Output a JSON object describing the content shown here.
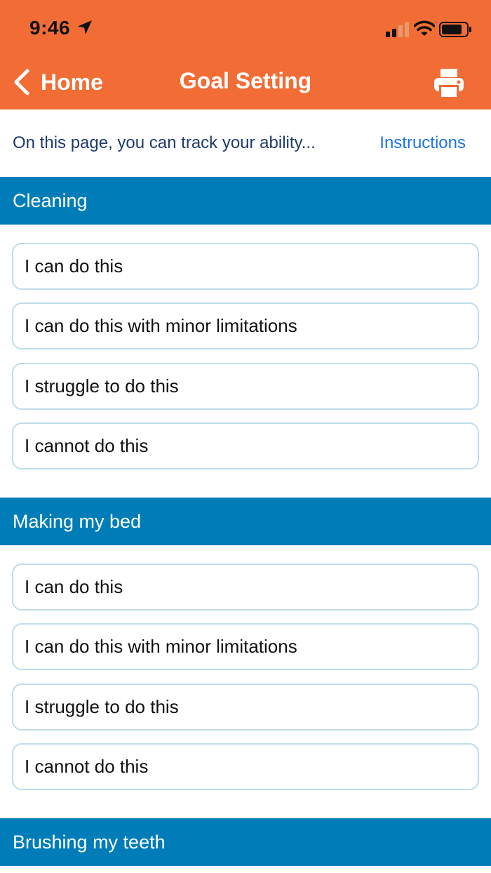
{
  "status_bar": {
    "time": "9:46",
    "icons": [
      "location-arrow-icon",
      "cellular-signal-icon",
      "wifi-icon",
      "battery-icon"
    ]
  },
  "nav": {
    "back_label": "Home",
    "title": "Goal Setting",
    "print_icon": "printer-icon"
  },
  "intro": {
    "text": "On this page, you can track your ability...",
    "instructions_label": "Instructions"
  },
  "colors": {
    "header_orange": "#F26D35",
    "section_blue": "#007DB8",
    "link_blue": "#1A73E8",
    "option_border": "#BFDCEB"
  },
  "sections": [
    {
      "title": "Cleaning",
      "options": [
        "I can do this",
        "I can do this with minor limitations",
        "I struggle to do this",
        "I cannot do this"
      ]
    },
    {
      "title": "Making my bed",
      "options": [
        "I can do this",
        "I can do this with minor limitations",
        "I struggle to do this",
        "I cannot do this"
      ]
    },
    {
      "title": "Brushing my teeth",
      "options": []
    }
  ]
}
